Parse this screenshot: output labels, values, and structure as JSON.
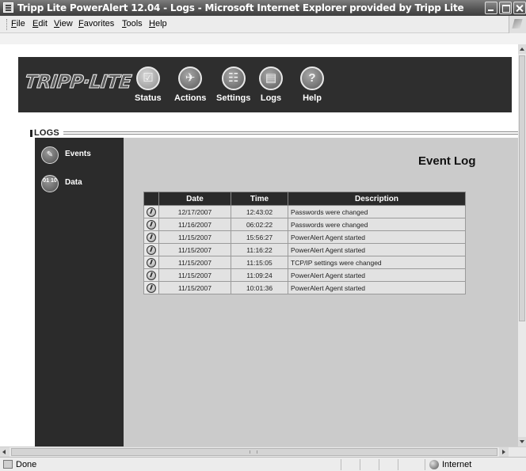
{
  "window": {
    "title": "Tripp Lite PowerAlert 12.04 - Logs - Microsoft Internet Explorer provided by Tripp Lite"
  },
  "menu": [
    "File",
    "Edit",
    "View",
    "Favorites",
    "Tools",
    "Help"
  ],
  "brand": {
    "logo_text": "TRIPP·LITE"
  },
  "nav": [
    {
      "label": "Status",
      "icon": "status-icon"
    },
    {
      "label": "Actions",
      "icon": "actions-icon"
    },
    {
      "label": "Settings",
      "icon": "settings-icon"
    },
    {
      "label": "Logs",
      "icon": "logs-icon"
    },
    {
      "label": "Help",
      "icon": "help-icon"
    }
  ],
  "section": {
    "label": "LOGS"
  },
  "sidebar": [
    {
      "label": "Events",
      "icon": "events-icon"
    },
    {
      "label": "Data",
      "icon": "data-icon",
      "glyph": "01 10"
    }
  ],
  "content": {
    "title": "Event Log"
  },
  "table": {
    "columns": [
      "Date",
      "Time",
      "Description"
    ],
    "rows": [
      {
        "date": "12/17/2007",
        "time": "12:43:02",
        "description": "Passwords were changed"
      },
      {
        "date": "11/16/2007",
        "time": "06:02:22",
        "description": "Passwords were changed"
      },
      {
        "date": "11/15/2007",
        "time": "15:56:27",
        "description": "PowerAlert Agent started"
      },
      {
        "date": "11/15/2007",
        "time": "11:16:22",
        "description": "PowerAlert Agent started"
      },
      {
        "date": "11/15/2007",
        "time": "11:15:05",
        "description": "TCP/IP settings were changed"
      },
      {
        "date": "11/15/2007",
        "time": "11:09:24",
        "description": "PowerAlert Agent started"
      },
      {
        "date": "11/15/2007",
        "time": "10:01:36",
        "description": "PowerAlert Agent started"
      }
    ]
  },
  "status": {
    "text": "Done",
    "zone": "Internet"
  }
}
